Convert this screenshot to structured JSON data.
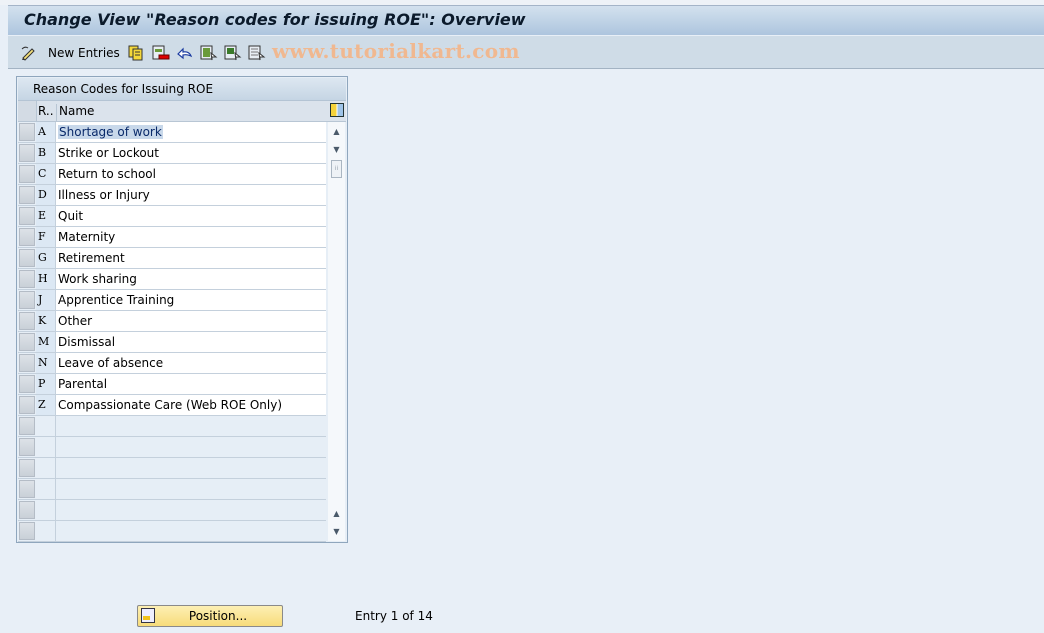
{
  "window": {
    "title": "Change View \"Reason codes for issuing ROE\": Overview"
  },
  "toolbar": {
    "new_entries_label": "New Entries",
    "icons": [
      "edit-pencil-icon",
      "copy-icon",
      "delete-icon",
      "undo-icon",
      "select-all-icon",
      "select-block-icon",
      "deselect-all-icon"
    ],
    "watermark": "www.tutorialkart.com"
  },
  "table": {
    "title": "Reason Codes for Issuing ROE",
    "columns": [
      "R..",
      "Name"
    ],
    "rows": [
      {
        "code": "A",
        "name": "Shortage of work"
      },
      {
        "code": "B",
        "name": "Strike or Lockout"
      },
      {
        "code": "C",
        "name": "Return to school"
      },
      {
        "code": "D",
        "name": "Illness or Injury"
      },
      {
        "code": "E",
        "name": "Quit"
      },
      {
        "code": "F",
        "name": "Maternity"
      },
      {
        "code": "G",
        "name": "Retirement"
      },
      {
        "code": "H",
        "name": "Work sharing"
      },
      {
        "code": "J",
        "name": "Apprentice Training"
      },
      {
        "code": "K",
        "name": "Other"
      },
      {
        "code": "M",
        "name": "Dismissal"
      },
      {
        "code": "N",
        "name": "Leave of absence"
      },
      {
        "code": "P",
        "name": "Parental"
      },
      {
        "code": "Z",
        "name": "Compassionate Care (Web ROE Only)"
      }
    ],
    "empty_rows": 6,
    "selected_row": 0
  },
  "footer": {
    "position_label": "Position...",
    "entry_text": "Entry 1 of 14"
  }
}
